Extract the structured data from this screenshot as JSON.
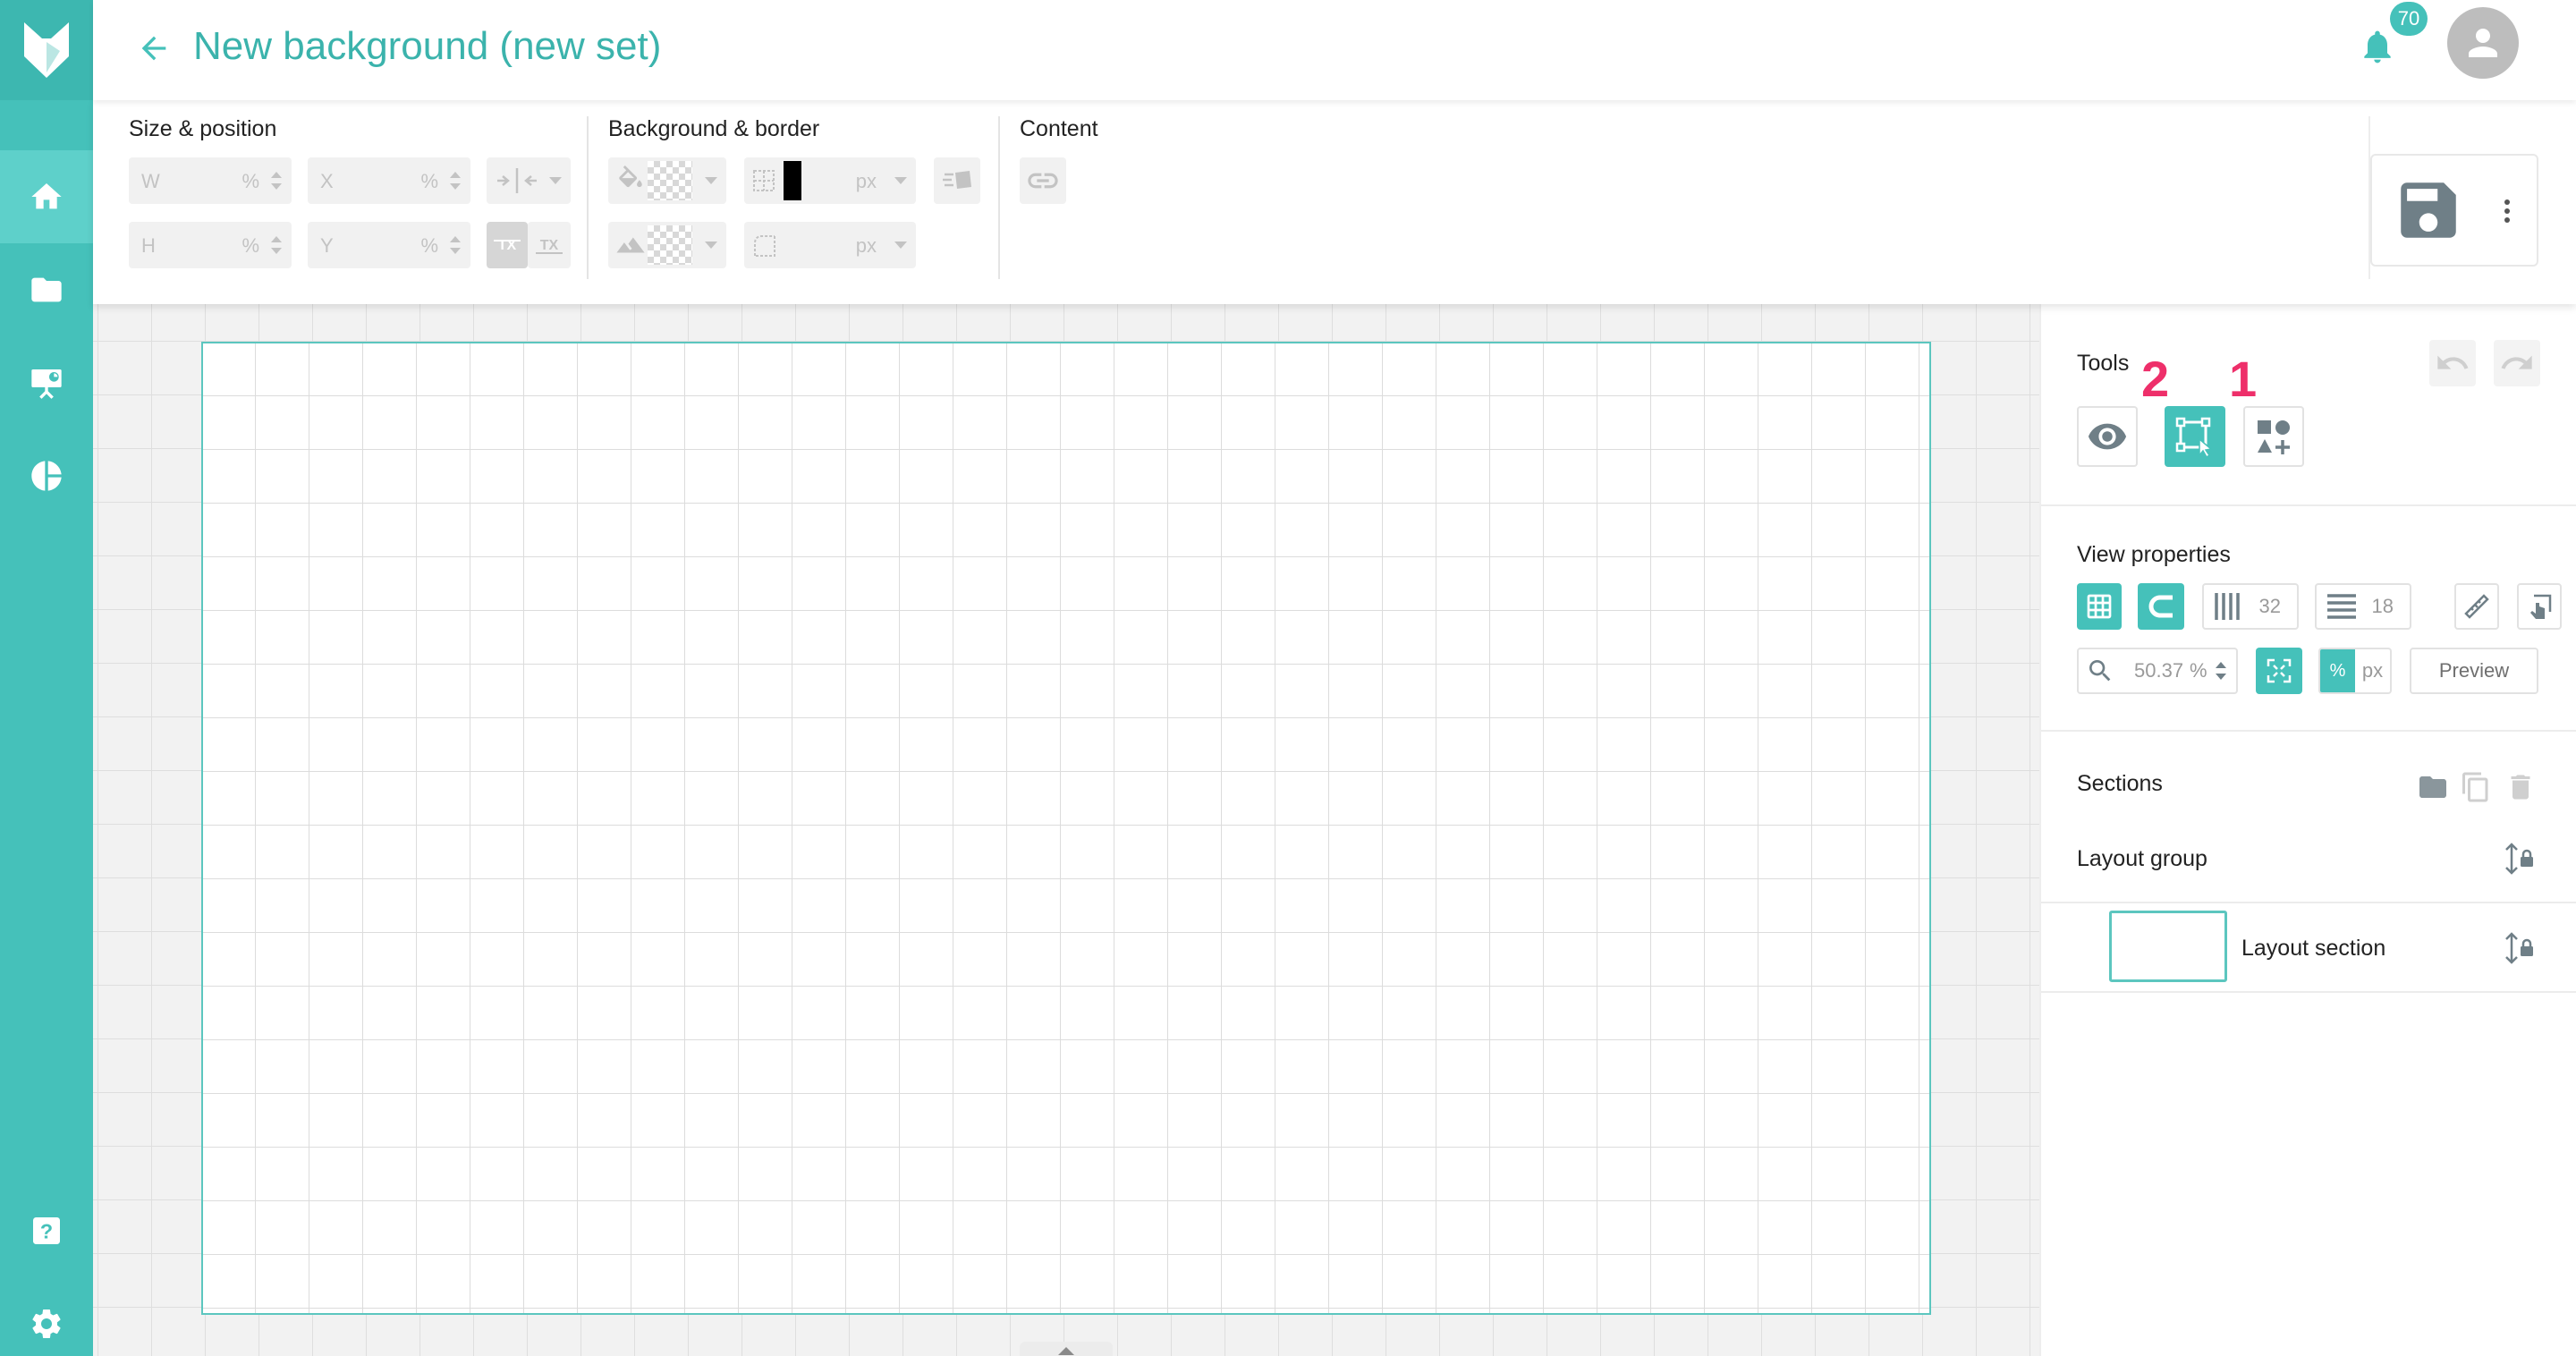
{
  "header": {
    "title": "New background (new set)",
    "notification_count": "70"
  },
  "sidebar": {
    "items": [
      {
        "name": "home",
        "active": true
      },
      {
        "name": "folder",
        "active": false
      },
      {
        "name": "presentation",
        "active": false
      },
      {
        "name": "chart",
        "active": false
      },
      {
        "name": "help",
        "active": false
      },
      {
        "name": "settings",
        "active": false
      }
    ]
  },
  "toolbar": {
    "size_position": {
      "label": "Size & position",
      "w_label": "W",
      "x_label": "X",
      "h_label": "H",
      "y_label": "Y",
      "unit_percent": "%"
    },
    "background_border": {
      "label": "Background & border",
      "unit_px": "px"
    },
    "content": {
      "label": "Content"
    }
  },
  "panel": {
    "tools_label": "Tools",
    "marker_1": "1",
    "marker_2": "2",
    "view_properties_label": "View properties",
    "columns_value": "32",
    "rows_value": "18",
    "zoom_value": "50.37",
    "zoom_unit": "%",
    "unit_percent": "%",
    "unit_px": "px",
    "preview_label": "Preview",
    "sections_label": "Sections",
    "layout_group_label": "Layout group",
    "layout_section_label": "Layout section"
  },
  "colors": {
    "accent": "#45c1ba",
    "marker": "#ee2f6a"
  }
}
